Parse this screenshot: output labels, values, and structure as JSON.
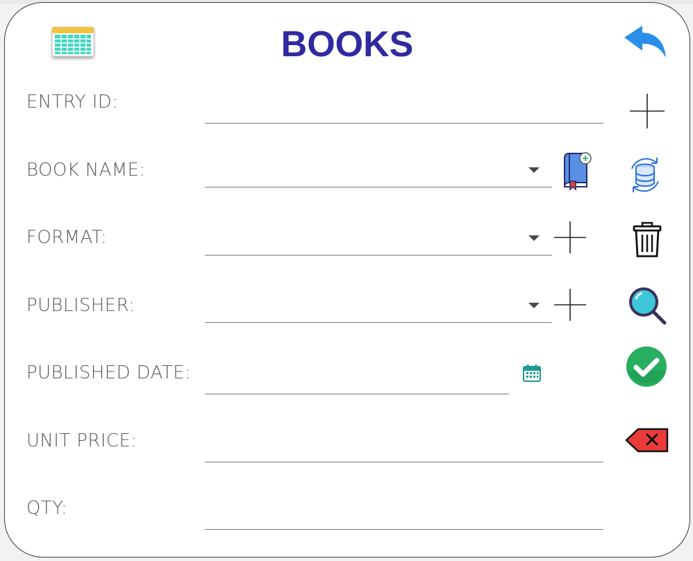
{
  "header": {
    "title": "BOOKS",
    "left_icon": "spreadsheet-icon",
    "back_icon": "undo-arrow-icon"
  },
  "fields": [
    {
      "key": "entry_id",
      "label": "ENTRY ID:",
      "value": "",
      "type": "text"
    },
    {
      "key": "book_name",
      "label": "BOOK NAME:",
      "value": "",
      "type": "combobox"
    },
    {
      "key": "format",
      "label": "FORMAT:",
      "value": "",
      "type": "combobox"
    },
    {
      "key": "publisher",
      "label": "PUBLISHER:",
      "value": "",
      "type": "combobox"
    },
    {
      "key": "published_date",
      "label": "PUBLISHED DATE:",
      "value": "",
      "type": "date"
    },
    {
      "key": "unit_price",
      "label": "UNIT PRICE:",
      "value": "",
      "type": "text"
    },
    {
      "key": "qty",
      "label": "QTY:",
      "value": "",
      "type": "text"
    }
  ],
  "side_actions": [
    "add-icon",
    "database-refresh-icon",
    "trash-icon",
    "search-icon",
    "check-icon",
    "clear-icon"
  ],
  "colors": {
    "title": "#2f2aa0",
    "back_arrow": "#2b8ee8",
    "check": "#27ae60",
    "clear": "#ea3b3b",
    "magnifier": "#3cc6d8"
  }
}
